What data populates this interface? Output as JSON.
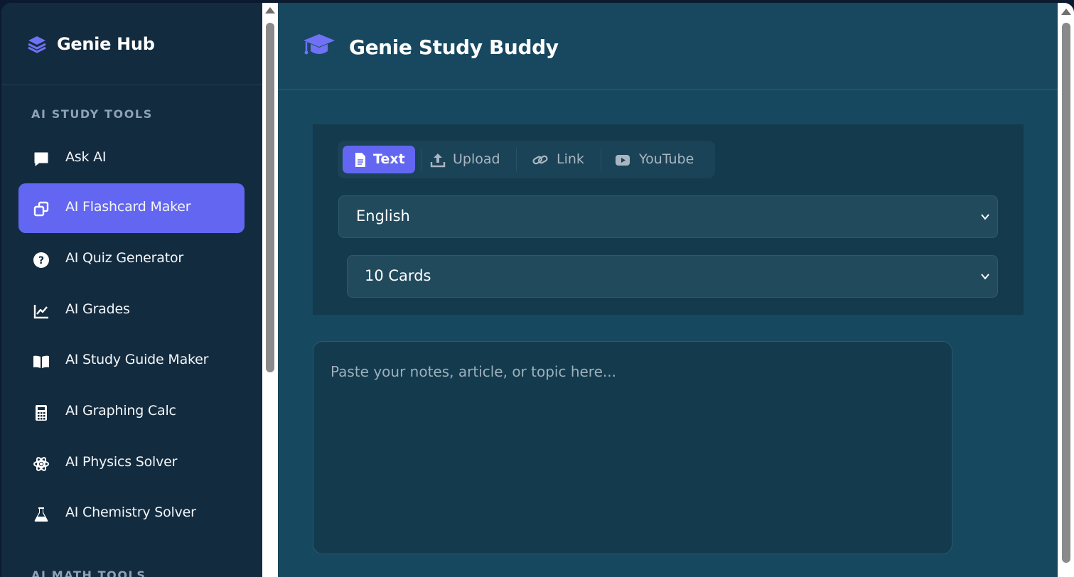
{
  "sidebar": {
    "brand": "Genie Hub",
    "section_study": "AI STUDY TOOLS",
    "section_math": "AI MATH TOOLS",
    "items": [
      {
        "label": "Ask AI",
        "icon": "chat-bubble-icon"
      },
      {
        "label": "AI Flashcard Maker",
        "icon": "flashcards-icon",
        "active": true
      },
      {
        "label": "AI Quiz Generator",
        "icon": "question-circle-icon"
      },
      {
        "label": "AI Grades",
        "icon": "line-chart-icon"
      },
      {
        "label": "AI Study Guide Maker",
        "icon": "open-book-icon"
      },
      {
        "label": "AI Graphing Calc",
        "icon": "calculator-icon"
      },
      {
        "label": "AI Physics Solver",
        "icon": "atom-icon"
      },
      {
        "label": "AI Chemistry Solver",
        "icon": "flask-icon"
      }
    ]
  },
  "header": {
    "title": "Genie Study Buddy"
  },
  "tabs": [
    {
      "label": "Text",
      "icon": "document-icon",
      "active": true
    },
    {
      "label": "Upload",
      "icon": "upload-icon"
    },
    {
      "label": "Link",
      "icon": "link-icon"
    },
    {
      "label": "YouTube",
      "icon": "youtube-icon"
    }
  ],
  "language_select": {
    "value": "English"
  },
  "cards_select": {
    "value": "10 Cards"
  },
  "notes": {
    "placeholder": "Paste your notes, article, or topic here..."
  },
  "colors": {
    "accent": "#6366f1",
    "sidebar_bg": "#132b3e",
    "main_bg": "#16485f",
    "panel_bg": "#133a4d"
  }
}
